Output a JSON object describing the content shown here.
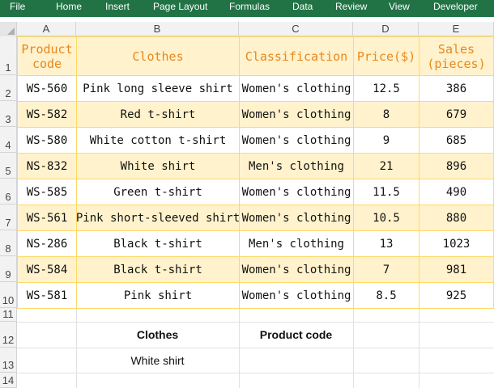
{
  "menu": [
    "File",
    "Home",
    "Insert",
    "Page Layout",
    "Formulas",
    "Data",
    "Review",
    "View",
    "Developer"
  ],
  "columns": [
    "A",
    "B",
    "C",
    "D",
    "E"
  ],
  "rows": [
    "1",
    "2",
    "3",
    "4",
    "5",
    "6",
    "7",
    "8",
    "9",
    "10",
    "11",
    "12",
    "13",
    "14"
  ],
  "table": {
    "headers": [
      {
        "line1": "Product",
        "line2": "code"
      },
      {
        "line1": "Clothes",
        "line2": ""
      },
      {
        "line1": "Classification",
        "line2": ""
      },
      {
        "line1": "Price($)",
        "line2": ""
      },
      {
        "line1": "Sales",
        "line2": "(pieces)"
      }
    ],
    "rows": [
      [
        "WS-560",
        "Pink long sleeve shirt",
        "Women's clothing",
        "12.5",
        "386"
      ],
      [
        "WS-582",
        "Red t-shirt",
        "Women's clothing",
        "8",
        "679"
      ],
      [
        "WS-580",
        "White cotton t-shirt",
        "Women's clothing",
        "9",
        "685"
      ],
      [
        "NS-832",
        "White shirt",
        "Men's clothing",
        "21",
        "896"
      ],
      [
        "WS-585",
        "Green t-shirt",
        "Women's clothing",
        "11.5",
        "490"
      ],
      [
        "WS-561",
        "Pink short-sleeved shirt",
        "Women's clothing",
        "10.5",
        "880"
      ],
      [
        "NS-286",
        "Black t-shirt",
        "Men's clothing",
        "13",
        "1023"
      ],
      [
        "WS-584",
        "Black t-shirt",
        "Women's clothing",
        "7",
        "981"
      ],
      [
        "WS-581",
        "Pink shirt",
        "Women's clothing",
        "8.5",
        "925"
      ]
    ]
  },
  "lookup": {
    "clothes_label": "Clothes",
    "code_label": "Product code",
    "clothes_value": "White shirt",
    "code_value": ""
  },
  "colors": {
    "ribbon": "#217346",
    "header_text": "#e8871e",
    "band": "#fff2cc",
    "border": "#ffd966"
  }
}
